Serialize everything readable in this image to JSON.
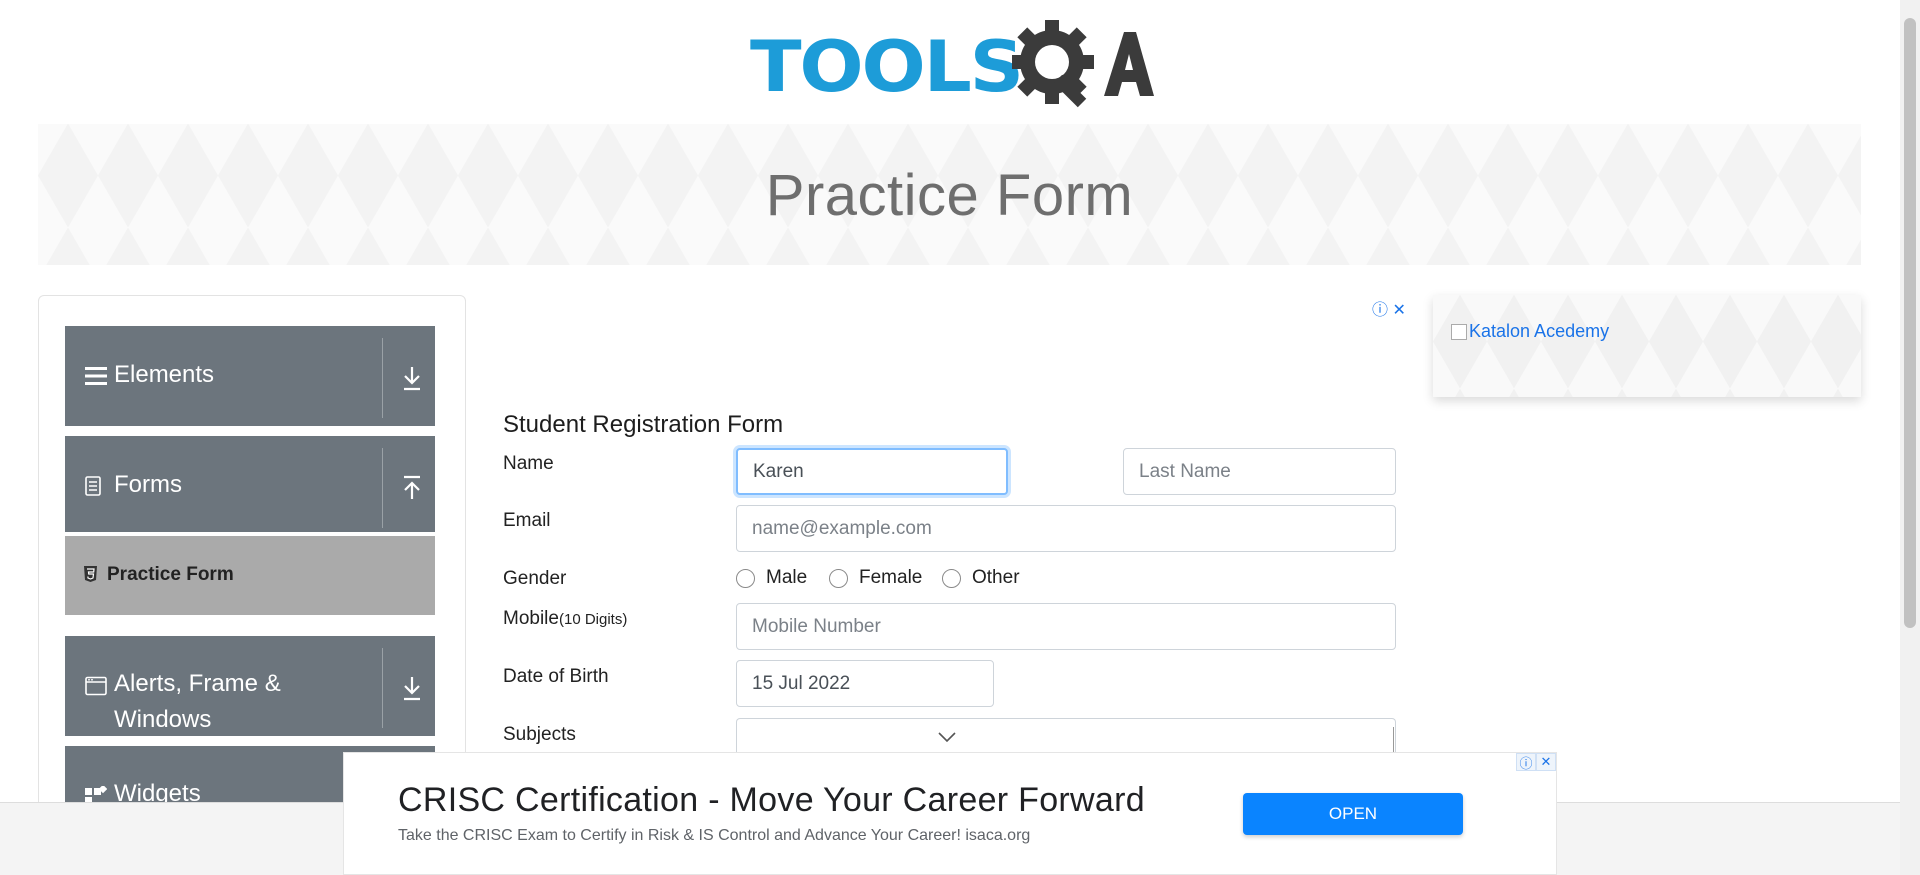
{
  "logo": {
    "text": "TOOLSQA",
    "word": "TOOLS"
  },
  "banner": {
    "title": "Practice Form"
  },
  "sidebar": {
    "groups": [
      {
        "label": "Elements"
      },
      {
        "label": "Forms"
      },
      {
        "label_line1": "Alerts, Frame &",
        "label_line2": "Windows"
      },
      {
        "label": "Widgets"
      }
    ],
    "active_item": "Practice Form"
  },
  "form": {
    "title": "Student Registration Form",
    "name_label": "Name",
    "first_name_value": "Karen",
    "last_name_placeholder": "Last Name",
    "email_label": "Email",
    "email_placeholder": "name@example.com",
    "gender_label": "Gender",
    "gender_options": [
      "Male",
      "Female",
      "Other"
    ],
    "mobile_label": "Mobile",
    "mobile_hint": "(10 Digits)",
    "mobile_placeholder": "Mobile Number",
    "dob_label": "Date of Birth",
    "dob_value": "15 Jul 2022",
    "subjects_label": "Subjects"
  },
  "side_ad": {
    "alt_text": "Katalon Acedemy"
  },
  "bottom_ad": {
    "headline": "CRISC Certification - Move Your Career Forward",
    "description": "Take the CRISC Exam to Certify in Risk & IS Control and Advance Your Career! isaca.org",
    "button_label": "OPEN"
  },
  "colors": {
    "logo_blue": "#1d9cd8",
    "logo_dark": "#3b3b3b",
    "sidebar_bg": "#6c757d",
    "active_bg": "#aaaaaa",
    "ad_button": "#0a84ff"
  }
}
